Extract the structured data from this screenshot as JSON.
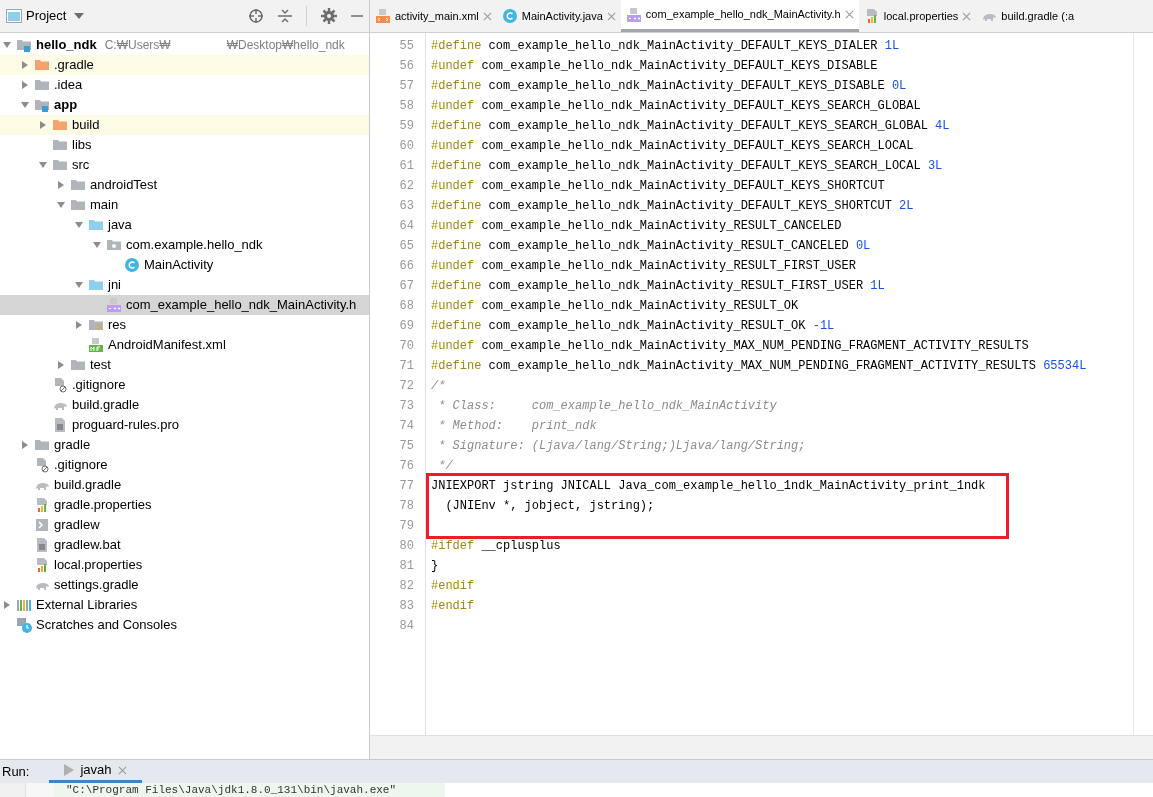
{
  "project_panel": {
    "title": "Project",
    "tree": [
      {
        "label": "hello_ndk",
        "kind": "module",
        "module": true,
        "expanded": true,
        "selected": false,
        "path_start": "C:₩Users₩",
        "path_end": "₩Desktop₩hello_ndk",
        "children": [
          {
            "label": ".gradle",
            "kind": "folder",
            "excluded": true,
            "expanded": false,
            "selected": false
          },
          {
            "label": ".idea",
            "kind": "folder",
            "expanded": false,
            "selected": false
          },
          {
            "label": "app",
            "kind": "module",
            "module": true,
            "expanded": true,
            "selected": false,
            "children": [
              {
                "label": "build",
                "kind": "folder",
                "excluded": true,
                "expanded": false,
                "selected": false
              },
              {
                "label": "libs",
                "kind": "folder",
                "selected": false
              },
              {
                "label": "src",
                "kind": "folder",
                "expanded": true,
                "selected": false,
                "children": [
                  {
                    "label": "androidTest",
                    "kind": "folder",
                    "expanded": false,
                    "selected": false
                  },
                  {
                    "label": "main",
                    "kind": "folder",
                    "expanded": true,
                    "selected": false,
                    "children": [
                      {
                        "label": "java",
                        "kind": "source",
                        "expanded": true,
                        "selected": false,
                        "children": [
                          {
                            "label": "com.example.hello_ndk",
                            "kind": "package",
                            "expanded": true,
                            "selected": false,
                            "children": [
                              {
                                "label": "MainActivity",
                                "kind": "class",
                                "selected": false
                              }
                            ]
                          }
                        ]
                      },
                      {
                        "label": "jni",
                        "kind": "source",
                        "expanded": true,
                        "selected": false,
                        "children": [
                          {
                            "label": "com_example_hello_ndk_MainActivity.h",
                            "kind": "header",
                            "selected": true
                          }
                        ]
                      },
                      {
                        "label": "res",
                        "kind": "resources",
                        "expanded": false,
                        "selected": false
                      },
                      {
                        "label": "AndroidManifest.xml",
                        "kind": "manifest",
                        "selected": false
                      }
                    ]
                  },
                  {
                    "label": "test",
                    "kind": "folder",
                    "expanded": false,
                    "selected": false
                  }
                ]
              },
              {
                "label": ".gitignore",
                "kind": "ignore",
                "selected": false
              },
              {
                "label": "build.gradle",
                "kind": "gradle",
                "selected": false
              },
              {
                "label": "proguard-rules.pro",
                "kind": "text",
                "selected": false
              }
            ]
          },
          {
            "label": "gradle",
            "kind": "folder",
            "expanded": false,
            "selected": false
          },
          {
            "label": ".gitignore",
            "kind": "ignore",
            "selected": false
          },
          {
            "label": "build.gradle",
            "kind": "gradle",
            "selected": false
          },
          {
            "label": "gradle.properties",
            "kind": "properties",
            "selected": false
          },
          {
            "label": "gradlew",
            "kind": "shell",
            "selected": false
          },
          {
            "label": "gradlew.bat",
            "kind": "text",
            "selected": false
          },
          {
            "label": "local.properties",
            "kind": "properties",
            "selected": false
          },
          {
            "label": "settings.gradle",
            "kind": "gradle",
            "selected": false
          }
        ]
      },
      {
        "label": "External Libraries",
        "kind": "libraries",
        "expanded": false,
        "selected": false
      },
      {
        "label": "Scratches and Consoles",
        "kind": "scratches",
        "selected": false
      }
    ]
  },
  "editor_tabs": [
    {
      "label": "activity_main.xml",
      "kind": "xml",
      "selected": false,
      "closable": true
    },
    {
      "label": "MainActivity.java",
      "kind": "class",
      "selected": false,
      "closable": true
    },
    {
      "label": "com_example_hello_ndk_MainActivity.h",
      "kind": "header",
      "selected": true,
      "closable": true
    },
    {
      "label": "local.properties",
      "kind": "properties",
      "selected": false,
      "closable": true
    },
    {
      "label": "build.gradle (:a",
      "kind": "gradle",
      "selected": false,
      "closable": false
    }
  ],
  "code_lines": [
    {
      "number": "55",
      "highlighted": false,
      "tokens": [
        {
          "kind": "directive",
          "text": "#define"
        },
        {
          "kind": "plain",
          "text": " com_example_hello_ndk_MainActivity_DEFAULT_KEYS_DIALER "
        },
        {
          "kind": "number",
          "text": "1L"
        }
      ]
    },
    {
      "number": "56",
      "highlighted": false,
      "tokens": [
        {
          "kind": "directive",
          "text": "#undef"
        },
        {
          "kind": "plain",
          "text": " com_example_hello_ndk_MainActivity_DEFAULT_KEYS_DISABLE"
        }
      ]
    },
    {
      "number": "57",
      "highlighted": false,
      "tokens": [
        {
          "kind": "directive",
          "text": "#define"
        },
        {
          "kind": "plain",
          "text": " com_example_hello_ndk_MainActivity_DEFAULT_KEYS_DISABLE "
        },
        {
          "kind": "number",
          "text": "0L"
        }
      ]
    },
    {
      "number": "58",
      "highlighted": false,
      "tokens": [
        {
          "kind": "directive",
          "text": "#undef"
        },
        {
          "kind": "plain",
          "text": " com_example_hello_ndk_MainActivity_DEFAULT_KEYS_SEARCH_GLOBAL"
        }
      ]
    },
    {
      "number": "59",
      "highlighted": false,
      "tokens": [
        {
          "kind": "directive",
          "text": "#define"
        },
        {
          "kind": "plain",
          "text": " com_example_hello_ndk_MainActivity_DEFAULT_KEYS_SEARCH_GLOBAL "
        },
        {
          "kind": "number",
          "text": "4L"
        }
      ]
    },
    {
      "number": "60",
      "highlighted": false,
      "tokens": [
        {
          "kind": "directive",
          "text": "#undef"
        },
        {
          "kind": "plain",
          "text": " com_example_hello_ndk_MainActivity_DEFAULT_KEYS_SEARCH_LOCAL"
        }
      ]
    },
    {
      "number": "61",
      "highlighted": false,
      "tokens": [
        {
          "kind": "directive",
          "text": "#define"
        },
        {
          "kind": "plain",
          "text": " com_example_hello_ndk_MainActivity_DEFAULT_KEYS_SEARCH_LOCAL "
        },
        {
          "kind": "number",
          "text": "3L"
        }
      ]
    },
    {
      "number": "62",
      "highlighted": false,
      "tokens": [
        {
          "kind": "directive",
          "text": "#undef"
        },
        {
          "kind": "plain",
          "text": " com_example_hello_ndk_MainActivity_DEFAULT_KEYS_SHORTCUT"
        }
      ]
    },
    {
      "number": "63",
      "highlighted": false,
      "tokens": [
        {
          "kind": "directive",
          "text": "#define"
        },
        {
          "kind": "plain",
          "text": " com_example_hello_ndk_MainActivity_DEFAULT_KEYS_SHORTCUT "
        },
        {
          "kind": "number",
          "text": "2L"
        }
      ]
    },
    {
      "number": "64",
      "highlighted": false,
      "tokens": [
        {
          "kind": "directive",
          "text": "#undef"
        },
        {
          "kind": "plain",
          "text": " com_example_hello_ndk_MainActivity_RESULT_CANCELED"
        }
      ]
    },
    {
      "number": "65",
      "highlighted": false,
      "tokens": [
        {
          "kind": "directive",
          "text": "#define"
        },
        {
          "kind": "plain",
          "text": " com_example_hello_ndk_MainActivity_RESULT_CANCELED "
        },
        {
          "kind": "number",
          "text": "0L"
        }
      ]
    },
    {
      "number": "66",
      "highlighted": false,
      "tokens": [
        {
          "kind": "directive",
          "text": "#undef"
        },
        {
          "kind": "plain",
          "text": " com_example_hello_ndk_MainActivity_RESULT_FIRST_USER"
        }
      ]
    },
    {
      "number": "67",
      "highlighted": false,
      "tokens": [
        {
          "kind": "directive",
          "text": "#define"
        },
        {
          "kind": "plain",
          "text": " com_example_hello_ndk_MainActivity_RESULT_FIRST_USER "
        },
        {
          "kind": "number",
          "text": "1L"
        }
      ]
    },
    {
      "number": "68",
      "highlighted": false,
      "tokens": [
        {
          "kind": "directive",
          "text": "#undef"
        },
        {
          "kind": "plain",
          "text": " com_example_hello_ndk_MainActivity_RESULT_OK"
        }
      ]
    },
    {
      "number": "69",
      "highlighted": false,
      "tokens": [
        {
          "kind": "directive",
          "text": "#define"
        },
        {
          "kind": "plain",
          "text": " com_example_hello_ndk_MainActivity_RESULT_OK "
        },
        {
          "kind": "number",
          "text": "-1L"
        }
      ]
    },
    {
      "number": "70",
      "highlighted": false,
      "tokens": [
        {
          "kind": "directive",
          "text": "#undef"
        },
        {
          "kind": "plain",
          "text": " com_example_hello_ndk_MainActivity_MAX_NUM_PENDING_FRAGMENT_ACTIVITY_RESULTS"
        }
      ]
    },
    {
      "number": "71",
      "highlighted": false,
      "tokens": [
        {
          "kind": "directive",
          "text": "#define"
        },
        {
          "kind": "plain",
          "text": " com_example_hello_ndk_MainActivity_MAX_NUM_PENDING_FRAGMENT_ACTIVITY_RESULTS "
        },
        {
          "kind": "number",
          "text": "65534L"
        }
      ]
    },
    {
      "number": "72",
      "highlighted": false,
      "tokens": [
        {
          "kind": "comment",
          "text": "/*"
        }
      ]
    },
    {
      "number": "73",
      "highlighted": false,
      "tokens": [
        {
          "kind": "comment",
          "text": " * Class:     com_example_hello_ndk_MainActivity"
        }
      ]
    },
    {
      "number": "74",
      "highlighted": false,
      "tokens": [
        {
          "kind": "comment",
          "text": " * Method:    print_ndk"
        }
      ]
    },
    {
      "number": "75",
      "highlighted": false,
      "tokens": [
        {
          "kind": "comment",
          "text": " * Signature: (Ljava/lang/String;)Ljava/lang/String;"
        }
      ]
    },
    {
      "number": "76",
      "highlighted": false,
      "tokens": [
        {
          "kind": "comment",
          "text": " */"
        }
      ]
    },
    {
      "number": "77",
      "highlighted": true,
      "tokens": [
        {
          "kind": "plain",
          "text": "JNIEXPORT jstring JNICALL Java_com_example_hello_1ndk_MainActivity_print_1ndk"
        }
      ]
    },
    {
      "number": "78",
      "highlighted": true,
      "tokens": [
        {
          "kind": "plain",
          "text": "  (JNIEnv *, jobject, jstring);"
        }
      ]
    },
    {
      "number": "79",
      "highlighted": true
    },
    {
      "number": "80",
      "highlighted": false,
      "tokens": [
        {
          "kind": "directive",
          "text": "#ifdef"
        },
        {
          "kind": "plain",
          "text": " __cplusplus"
        }
      ]
    },
    {
      "number": "81",
      "highlighted": false,
      "tokens": [
        {
          "kind": "plain",
          "text": "}"
        }
      ]
    },
    {
      "number": "82",
      "highlighted": false,
      "tokens": [
        {
          "kind": "directive",
          "text": "#endif"
        }
      ]
    },
    {
      "number": "83",
      "highlighted": false,
      "tokens": [
        {
          "kind": "directive",
          "text": "#endif"
        }
      ]
    },
    {
      "number": "84",
      "highlighted": false
    }
  ],
  "run_panel": {
    "label": "Run:",
    "tabs": [
      {
        "label": "javah",
        "selected": true
      }
    ],
    "console_line": "\"C:\\Program Files\\Java\\jdk1.8.0_131\\bin\\javah.exe\""
  }
}
